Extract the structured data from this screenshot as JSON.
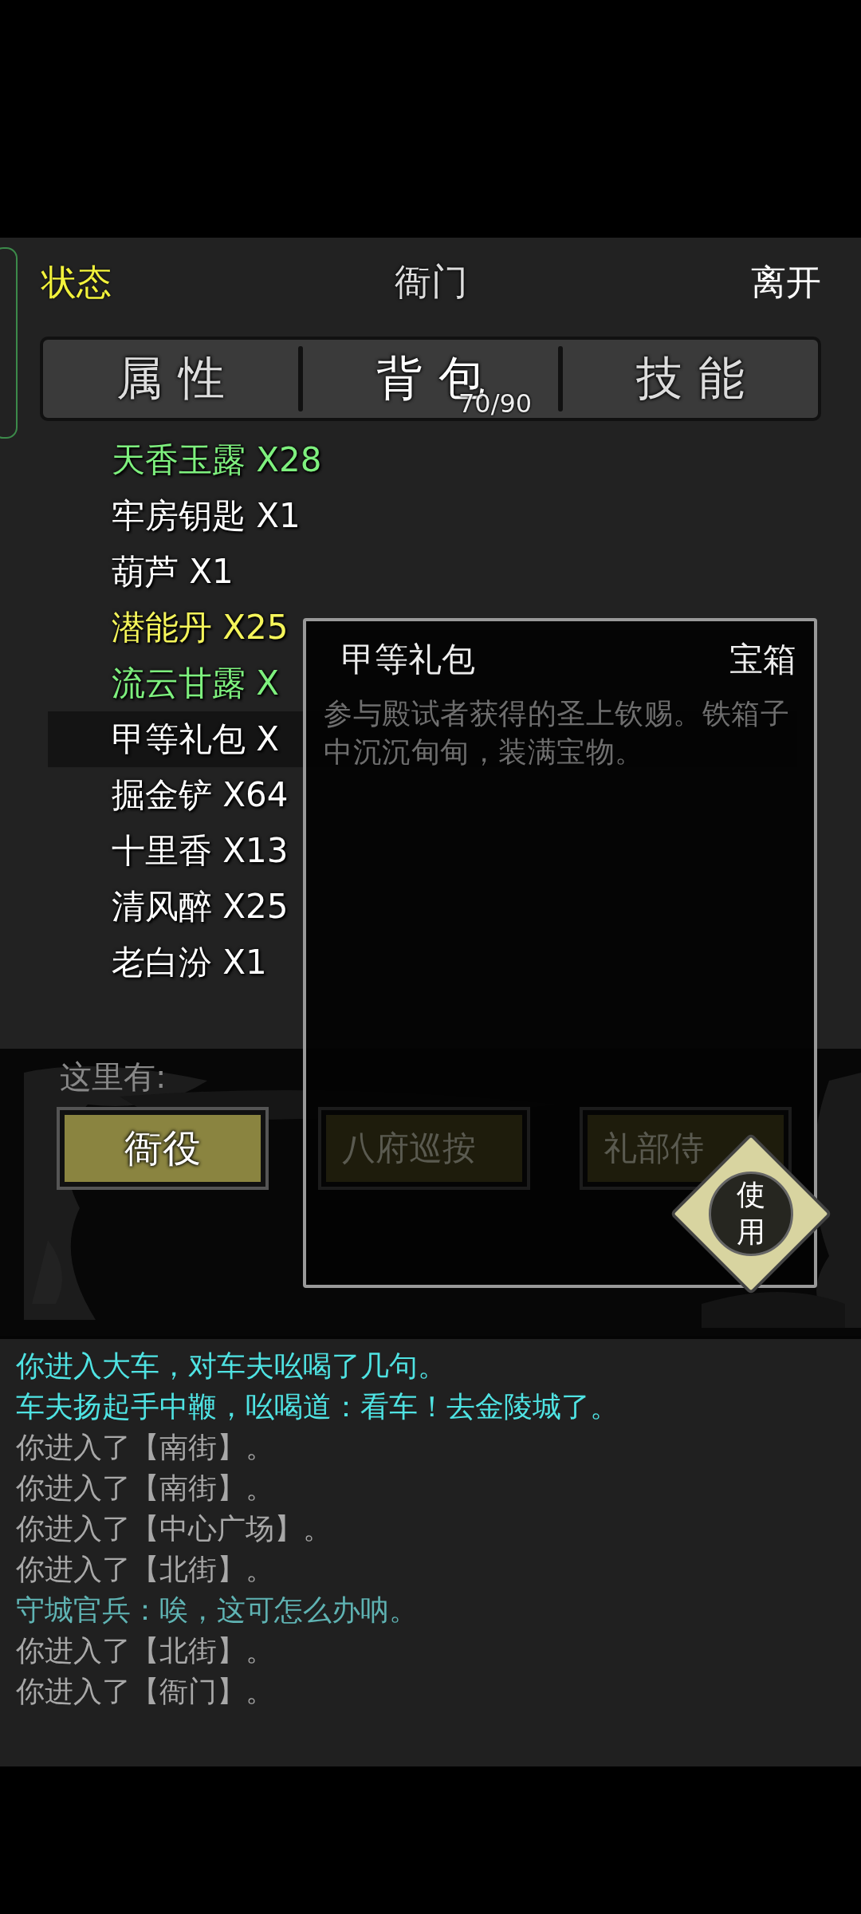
{
  "header": {
    "status": "状态",
    "title": "衙门",
    "leave": "离开"
  },
  "tabs": [
    {
      "label": "属性",
      "selected": false
    },
    {
      "label": "背包",
      "selected": true,
      "count": "70/90"
    },
    {
      "label": "技能",
      "selected": false
    }
  ],
  "items": [
    {
      "label": "天香玉露 X28",
      "color": "#7ef07e",
      "selected": false
    },
    {
      "label": "牢房钥匙 X1",
      "color": "#ffffff",
      "selected": false
    },
    {
      "label": "葫芦 X1",
      "color": "#ffffff",
      "selected": false
    },
    {
      "label": "潜能丹 X25",
      "color": "#f5f55a",
      "selected": false
    },
    {
      "label": "流云甘露 X",
      "color": "#7ef07e",
      "selected": false
    },
    {
      "label": "甲等礼包 X",
      "color": "#ffffff",
      "selected": true
    },
    {
      "label": "掘金铲 X64",
      "color": "#ffffff",
      "selected": false
    },
    {
      "label": "十里香 X13",
      "color": "#ffffff",
      "selected": false
    },
    {
      "label": "清风醉 X25",
      "color": "#ffffff",
      "selected": false
    },
    {
      "label": "老白汾 X1",
      "color": "#ffffff",
      "selected": false
    }
  ],
  "here": {
    "label": "这里有:",
    "npcs": [
      {
        "label": "衙役",
        "disabled": false
      },
      {
        "label": "八府巡按",
        "disabled": true
      },
      {
        "label": "礼部侍",
        "disabled": true
      }
    ]
  },
  "popup": {
    "name": "甲等礼包",
    "type": "宝箱",
    "description": "参与殿试者获得的圣上钦赐。铁箱子中沉沉甸甸，装满宝物。",
    "action": "使用"
  },
  "log": [
    {
      "text": "你进入大车，对车夫吆喝了几句。",
      "color": "#4fe3e3"
    },
    {
      "text": "车夫扬起手中鞭，吆喝道：看车！去金陵城了。",
      "color": "#4fe3e3"
    },
    {
      "text": "你进入了【南街】。",
      "color": "#a8a8a8"
    },
    {
      "text": "你进入了【南街】。",
      "color": "#a8a8a8"
    },
    {
      "text": "你进入了【中心广场】。",
      "color": "#a8a8a8"
    },
    {
      "text": "你进入了【北街】。",
      "color": "#a8a8a8"
    },
    {
      "text": "守城官兵：唉，这可怎么办呐。",
      "color": "#5fb3b3"
    },
    {
      "text": "你进入了【北街】。",
      "color": "#a8a8a8"
    },
    {
      "text": "你进入了【衙门】。",
      "color": "#a8a8a8"
    }
  ]
}
